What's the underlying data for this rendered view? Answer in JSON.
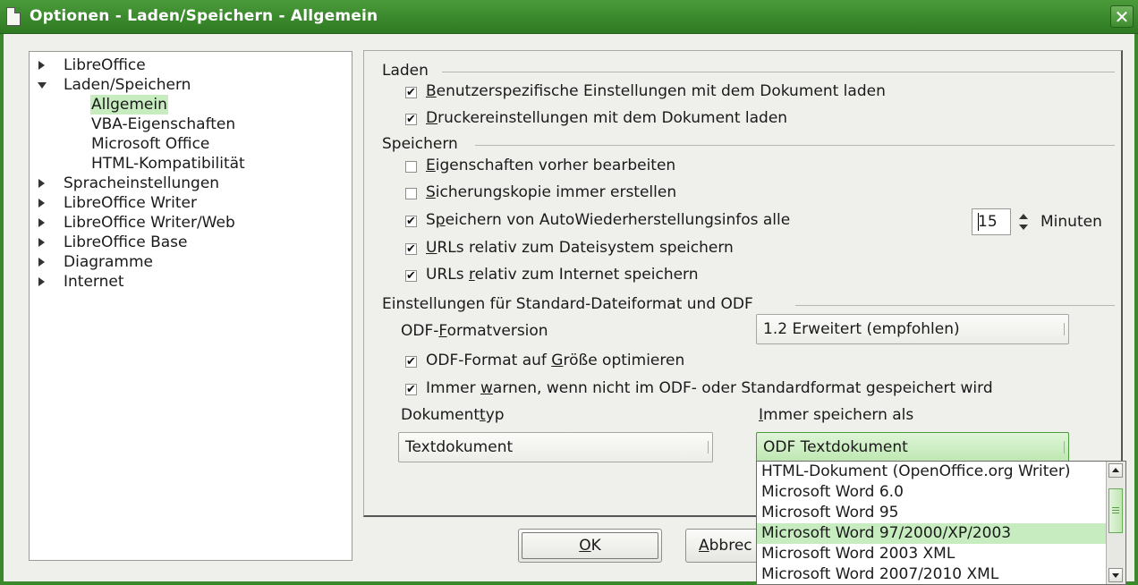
{
  "window": {
    "title": "Optionen - Laden/Speichern - Allgemein",
    "close_glyph": "✕"
  },
  "tree": {
    "items": [
      {
        "label": "LibreOffice",
        "state": "collapsed"
      },
      {
        "label": "Laden/Speichern",
        "state": "expanded"
      },
      {
        "label": "Allgemein",
        "state": "selected-child"
      },
      {
        "label": "VBA-Eigenschaften",
        "state": "child"
      },
      {
        "label": "Microsoft Office",
        "state": "child"
      },
      {
        "label": "HTML-Kompatibilität",
        "state": "child"
      },
      {
        "label": "Spracheinstellungen",
        "state": "collapsed"
      },
      {
        "label": "LibreOffice Writer",
        "state": "collapsed"
      },
      {
        "label": "LibreOffice Writer/Web",
        "state": "collapsed"
      },
      {
        "label": "LibreOffice Base",
        "state": "collapsed"
      },
      {
        "label": "Diagramme",
        "state": "collapsed"
      },
      {
        "label": "Internet",
        "state": "collapsed"
      }
    ]
  },
  "laden": {
    "heading": "Laden",
    "options": [
      {
        "ul": "B",
        "rest": "enutzerspezifische Einstellungen mit dem Dokument laden",
        "checked": true
      },
      {
        "ul": "D",
        "rest": "ruckereinstellungen mit dem Dokument laden",
        "checked": true
      }
    ]
  },
  "speichern": {
    "heading": "Speichern",
    "options": [
      {
        "pre": "",
        "ul": "E",
        "rest": "igenschaften vorher bearbeiten",
        "checked": false
      },
      {
        "pre": "",
        "ul": "S",
        "rest": "icherungskopie immer erstellen",
        "checked": false
      },
      {
        "pre": "S",
        "ul": "p",
        "rest": "eichern von AutoWiederherstellungsinfos alle",
        "checked": true
      },
      {
        "pre": "",
        "ul": "U",
        "rest": "RLs relativ zum Dateisystem speichern",
        "checked": true
      },
      {
        "pre": "URLs ",
        "ul": "r",
        "rest": "elativ zum Internet speichern",
        "checked": true
      }
    ],
    "autosave_minutes": "15",
    "minutes_label": "Minuten"
  },
  "odf": {
    "heading": "Einstellungen für Standard-Dateiformat und ODF",
    "version_label_pre": "ODF-",
    "version_label_ul": "F",
    "version_label_rest": "ormatversion",
    "version_value": "1.2 Erweitert (empfohlen)",
    "opt_size_pre": "ODF-Format auf ",
    "opt_size_ul": "G",
    "opt_size_rest": "röße optimieren",
    "opt_size_checked": true,
    "opt_warn_pre": "Immer ",
    "opt_warn_ul": "w",
    "opt_warn_rest": "arnen, wenn nicht im ODF- oder Standardformat gespeichert wird",
    "opt_warn_checked": true,
    "doctype_label_pre": "Dokument",
    "doctype_label_ul": "t",
    "doctype_label_rest": "yp",
    "doctype_value": "Textdokument",
    "saveas_label_ul": "I",
    "saveas_label_rest": "mmer speichern als",
    "saveas_value": "ODF Textdokument"
  },
  "dropdown": {
    "items": [
      "HTML-Dokument (OpenOffice.org Writer)",
      "Microsoft Word 6.0",
      "Microsoft Word 95",
      "Microsoft Word 97/2000/XP/2003",
      "Microsoft Word 2003 XML",
      "Microsoft Word 2007/2010 XML"
    ],
    "highlighted_index": 3
  },
  "buttons": {
    "ok_ul": "O",
    "ok_rest": "K",
    "cancel_ul": "A",
    "cancel_rest": "bbrec"
  },
  "icons": {
    "check": "✔"
  }
}
